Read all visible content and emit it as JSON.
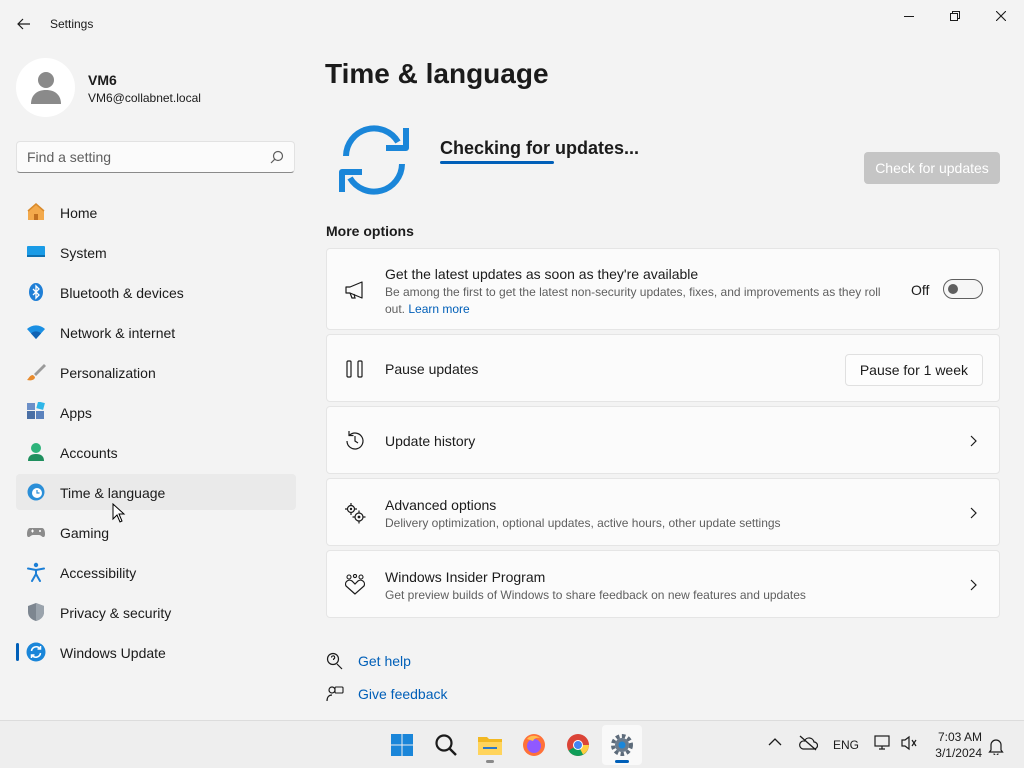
{
  "window": {
    "title": "Settings",
    "back": "back",
    "controls": [
      "minimize",
      "restore",
      "close"
    ]
  },
  "profile": {
    "name": "VM6",
    "email": "VM6@collabnet.local"
  },
  "search": {
    "placeholder": "Find a setting"
  },
  "sidebar": {
    "items": [
      {
        "label": "Home",
        "icon": "home-icon"
      },
      {
        "label": "System",
        "icon": "system-icon"
      },
      {
        "label": "Bluetooth & devices",
        "icon": "bluetooth-icon"
      },
      {
        "label": "Network & internet",
        "icon": "wifi-icon"
      },
      {
        "label": "Personalization",
        "icon": "brush-icon"
      },
      {
        "label": "Apps",
        "icon": "apps-icon"
      },
      {
        "label": "Accounts",
        "icon": "accounts-icon"
      },
      {
        "label": "Time & language",
        "icon": "time-language-icon"
      },
      {
        "label": "Gaming",
        "icon": "gamepad-icon"
      },
      {
        "label": "Accessibility",
        "icon": "accessibility-icon"
      },
      {
        "label": "Privacy & security",
        "icon": "shield-icon"
      },
      {
        "label": "Windows Update",
        "icon": "windows-update-icon"
      }
    ],
    "selected": "Windows Update",
    "hovered": "Time & language"
  },
  "main": {
    "title": "Time & language",
    "status": "Checking for updates...",
    "progress": 0.6,
    "check_button": "Check for updates",
    "more_options": "More options",
    "latest_updates": {
      "title": "Get the latest updates as soon as they're available",
      "desc": "Be among the first to get the latest non-security updates, fixes, and improvements as they roll out.",
      "link": "Learn more",
      "toggle_label": "Off",
      "toggle_on": false
    },
    "pause": {
      "title": "Pause updates",
      "button": "Pause for 1 week"
    },
    "history": {
      "title": "Update history"
    },
    "advanced": {
      "title": "Advanced options",
      "desc": "Delivery optimization, optional updates, active hours, other update settings"
    },
    "insider": {
      "title": "Windows Insider Program",
      "desc": "Get preview builds of Windows to share feedback on new features and updates"
    },
    "help": "Get help",
    "feedback": "Give feedback"
  },
  "taskbar": {
    "apps": [
      "start-icon",
      "search-icon",
      "file-explorer-icon",
      "firefox-icon",
      "chrome-icon",
      "settings-icon"
    ],
    "tray": {
      "lang": "ENG",
      "time": "7:03 AM",
      "date": "3/1/2024"
    }
  },
  "colors": {
    "accent": "#005fb8",
    "background": "#f3f3f3",
    "card": "#fbfbfb"
  }
}
